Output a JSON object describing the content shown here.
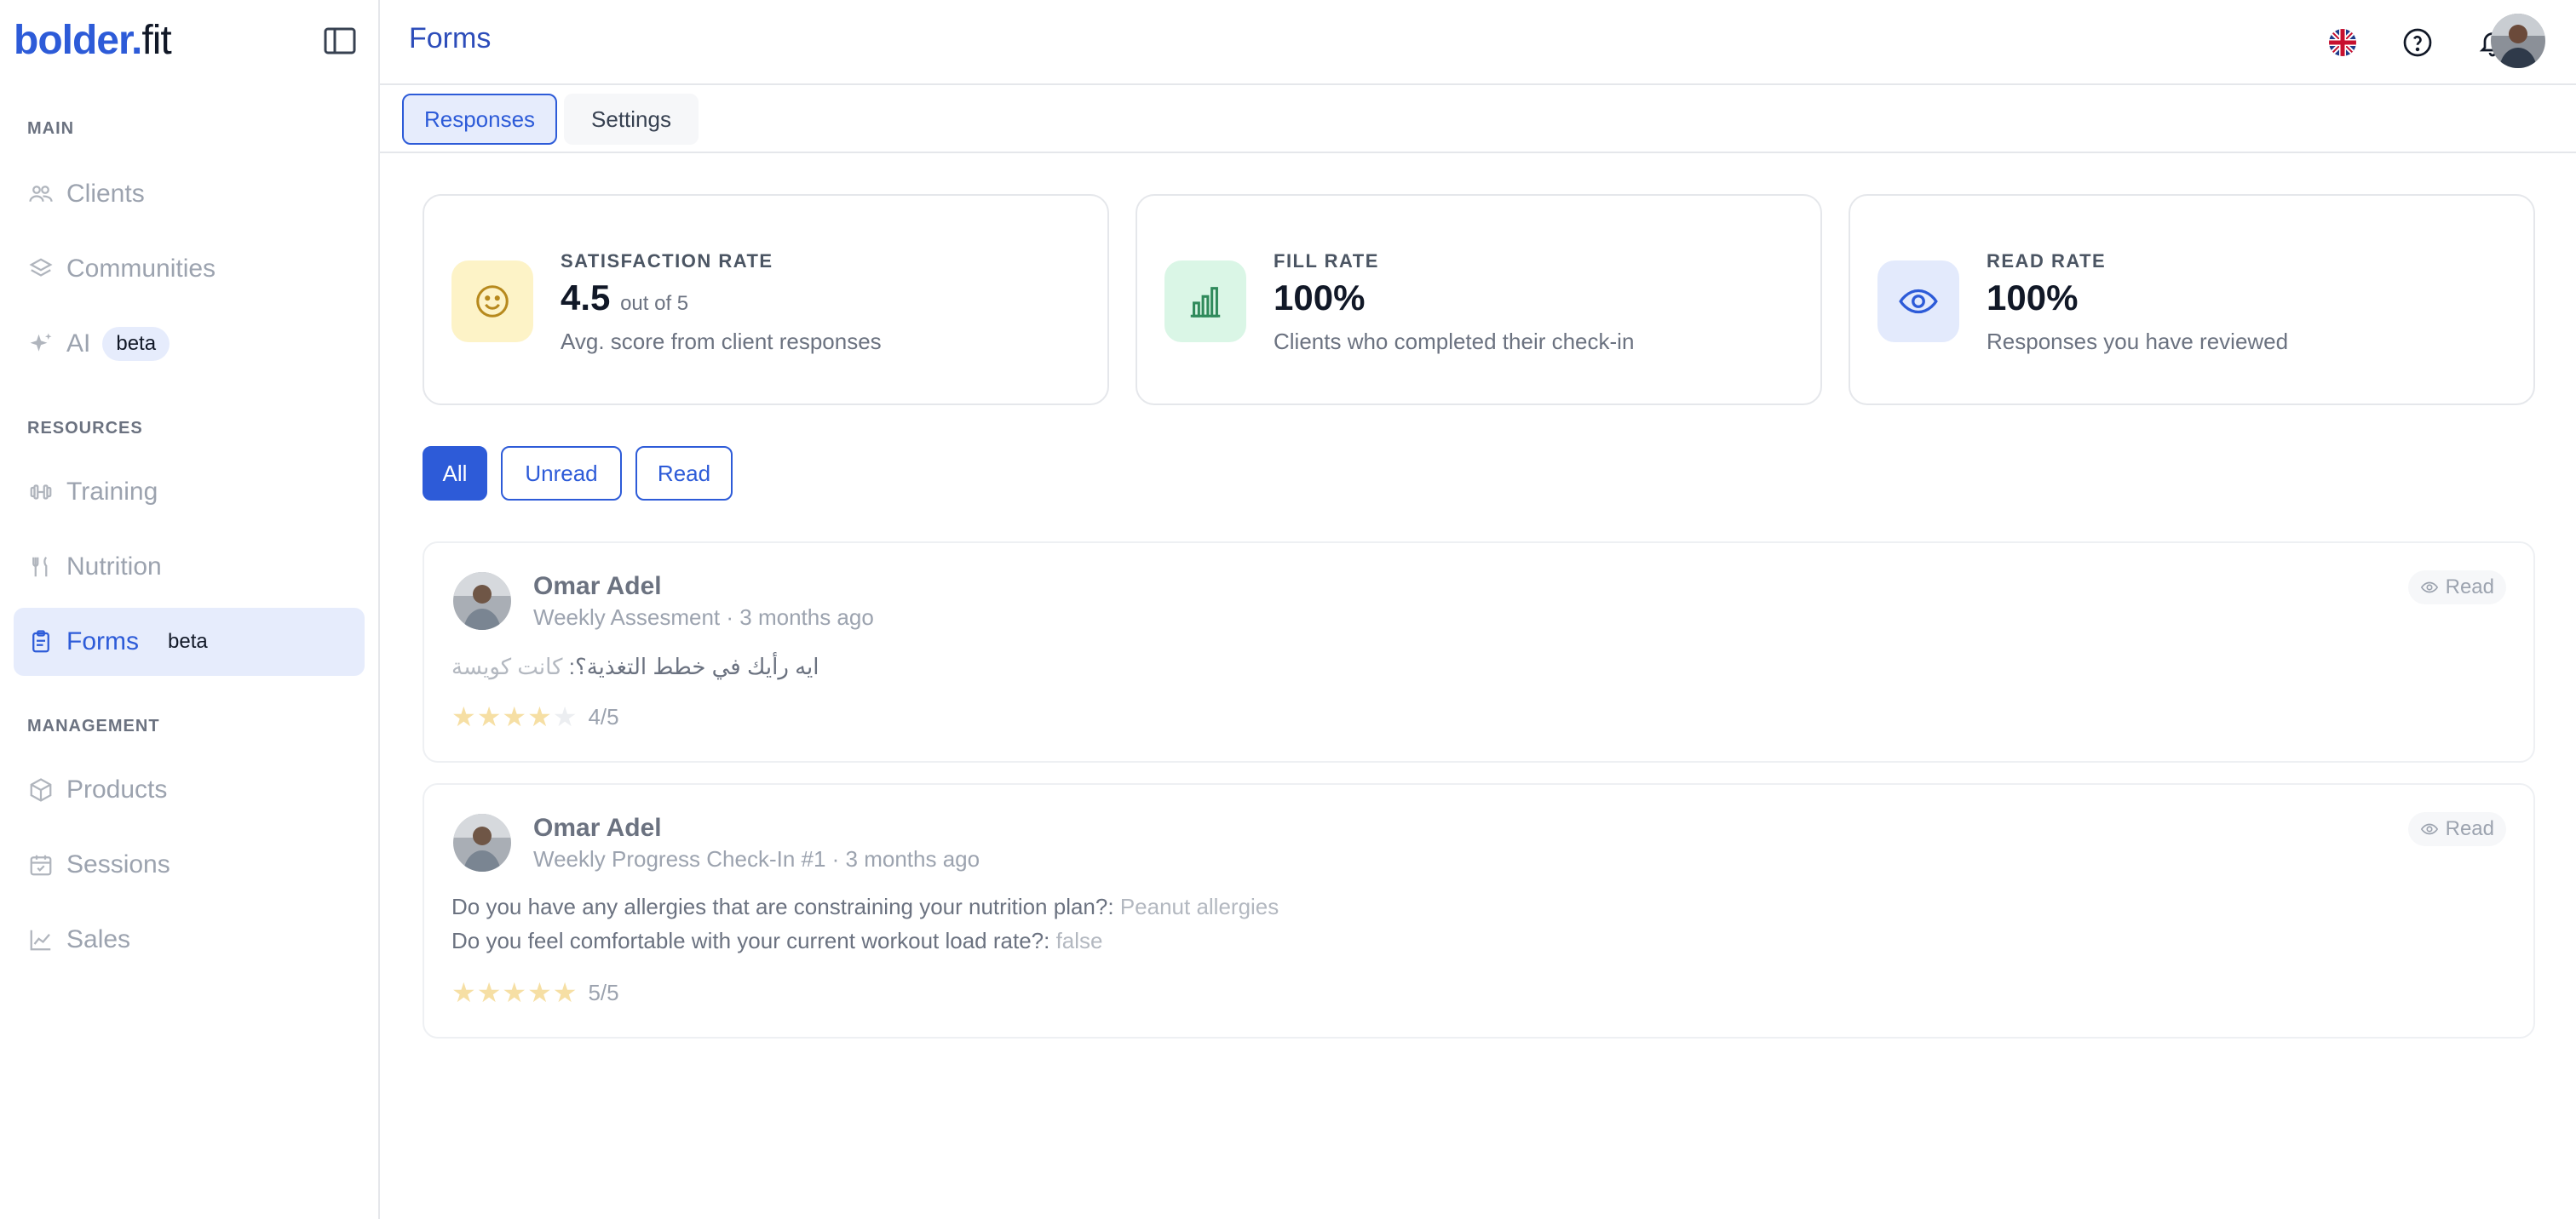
{
  "brand": {
    "logo_bold": "bolder.",
    "logo_light": "fit"
  },
  "header": {
    "title": "Forms"
  },
  "sidebar": {
    "sections": [
      {
        "title": "MAIN"
      },
      {
        "title": "RESOURCES"
      },
      {
        "title": "MANAGEMENT"
      }
    ],
    "items": [
      {
        "label": "Clients",
        "icon": "users-icon"
      },
      {
        "label": "Communities",
        "icon": "layers-icon"
      },
      {
        "label": "AI",
        "icon": "sparkles-icon",
        "badge": "beta"
      },
      {
        "label": "Training",
        "icon": "dumbbell-icon"
      },
      {
        "label": "Nutrition",
        "icon": "utensils-icon"
      },
      {
        "label": "Forms",
        "icon": "clipboard-icon",
        "badge": "beta",
        "active": true
      },
      {
        "label": "Products",
        "icon": "package-icon"
      },
      {
        "label": "Sessions",
        "icon": "calendar-check-icon"
      },
      {
        "label": "Sales",
        "icon": "chart-line-icon"
      }
    ]
  },
  "tabs": [
    {
      "label": "Responses",
      "active": true
    },
    {
      "label": "Settings",
      "active": false
    }
  ],
  "stats": [
    {
      "title": "SATISFACTION RATE",
      "value": "4.5",
      "value_suffix": "out of 5",
      "desc": "Avg. score from client responses",
      "icon": "smile-icon",
      "icon_bg": "#fdf3c7",
      "icon_color": "#b7891d"
    },
    {
      "title": "FILL RATE",
      "value": "100%",
      "value_suffix": "",
      "desc": "Clients who completed their check-in",
      "icon": "bar-chart-icon",
      "icon_bg": "#daf6e6",
      "icon_color": "#2f8a5b"
    },
    {
      "title": "READ RATE",
      "value": "100%",
      "value_suffix": "",
      "desc": "Responses you have reviewed",
      "icon": "eye-icon",
      "icon_bg": "#e3eafc",
      "icon_color": "#2d5bd8"
    }
  ],
  "filters": [
    {
      "label": "All",
      "active": true
    },
    {
      "label": "Unread",
      "active": false
    },
    {
      "label": "Read",
      "active": false
    }
  ],
  "responses": [
    {
      "name": "Omar Adel",
      "meta": "Weekly Assesment · 3 months ago",
      "status": "Read",
      "qa": [
        {
          "q": "ايه رأيك في خطط التغذية؟:",
          "a": "كانت كويسة"
        }
      ],
      "rating": 4,
      "rating_label": "4/5"
    },
    {
      "name": "Omar Adel",
      "meta": "Weekly Progress Check-In #1 · 3 months ago",
      "status": "Read",
      "qa": [
        {
          "q": "Do you have any allergies that are constraining your nutrition plan?:",
          "a": "Peanut allergies"
        },
        {
          "q": "Do you feel comfortable with your current workout load rate?:",
          "a": "false"
        }
      ],
      "rating": 5,
      "rating_label": "5/5"
    }
  ],
  "colors": {
    "accent": "#2d5bd8",
    "accent_soft": "#e6ecfc",
    "star": "#f6dfa4"
  }
}
